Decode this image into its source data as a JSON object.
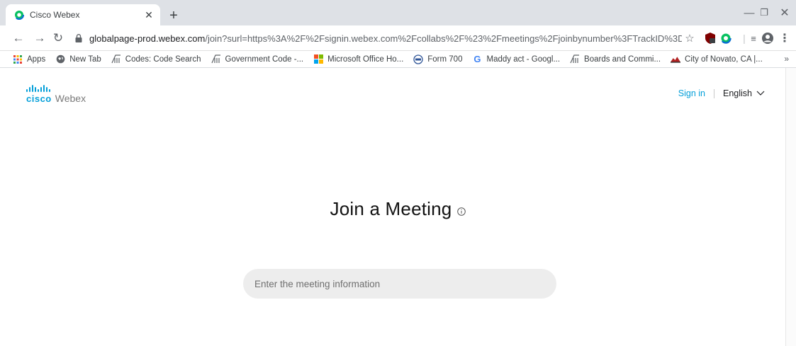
{
  "browser": {
    "tab": {
      "title": "Cisco Webex"
    },
    "address": {
      "host": "globalpage-prod.webex.com",
      "path": "/join?surl=https%3A%2F%2Fsignin.webex.com%2Fcollabs%2F%23%2Fmeetings%2Fjoinbynumber%3FTrackID%3D%2..."
    },
    "bookmarks": [
      {
        "label": "Apps",
        "icon": "apps-grid-icon"
      },
      {
        "label": "New Tab",
        "icon": "globe-icon"
      },
      {
        "label": "Codes: Code Search",
        "icon": "pillar-icon"
      },
      {
        "label": "Government Code -...",
        "icon": "pillar-icon"
      },
      {
        "label": "Microsoft Office Ho...",
        "icon": "microsoft-icon"
      },
      {
        "label": "Form 700",
        "icon": "form-icon"
      },
      {
        "label": "Maddy act - Googl...",
        "icon": "google-icon"
      },
      {
        "label": "Boards and Commi...",
        "icon": "pillar-icon"
      },
      {
        "label": "City of Novato, CA |...",
        "icon": "city-icon"
      }
    ],
    "more_bookmarks": "»"
  },
  "page": {
    "logo": {
      "cisco": "cisco",
      "product": "Webex"
    },
    "header": {
      "signin": "Sign in",
      "language": "English"
    },
    "heading": "Join a Meeting",
    "search": {
      "placeholder": "Enter the meeting information",
      "value": ""
    }
  },
  "colors": {
    "accent": "#049fd9",
    "input_bg": "#ededed",
    "tabstrip_bg": "#dee1e6"
  }
}
